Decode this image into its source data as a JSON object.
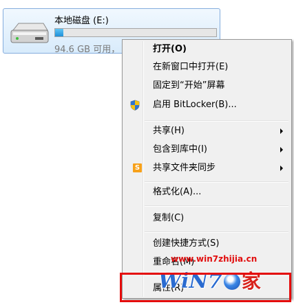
{
  "drive": {
    "name": "本地磁盘 (E:)",
    "free_text": "94.6 GB 可用，",
    "used_fraction": 0.05,
    "icon": "hard-drive-icon"
  },
  "menu": {
    "items": [
      {
        "label": "打开(O)",
        "bold": true
      },
      {
        "label": "在新窗口中打开(E)"
      },
      {
        "label": "固定到“开始”屏幕"
      },
      {
        "label": "启用 BitLocker(B)...",
        "icon": "shield-icon"
      },
      {
        "label": "共享(H)",
        "submenu": true
      },
      {
        "label": "包含到库中(I)",
        "submenu": true
      },
      {
        "label": "共享文件夹同步",
        "submenu": true,
        "icon": "s-sync-icon",
        "icon_text": "S"
      },
      {
        "label": "格式化(A)..."
      },
      {
        "label": "复制(C)"
      },
      {
        "label": "创建快捷方式(S)"
      },
      {
        "label": "重命名(M)"
      },
      {
        "label": "属性(R)"
      }
    ]
  },
  "watermark": {
    "url": "www.win7zhijia.cn",
    "logo_text": "WiN7",
    "logo_cjk": "家"
  },
  "colors": {
    "highlight": "#e50c0c",
    "drive_fill": "#1f90d8",
    "watermark_blue": "#2a6bd0",
    "watermark_red": "#d8231c"
  }
}
